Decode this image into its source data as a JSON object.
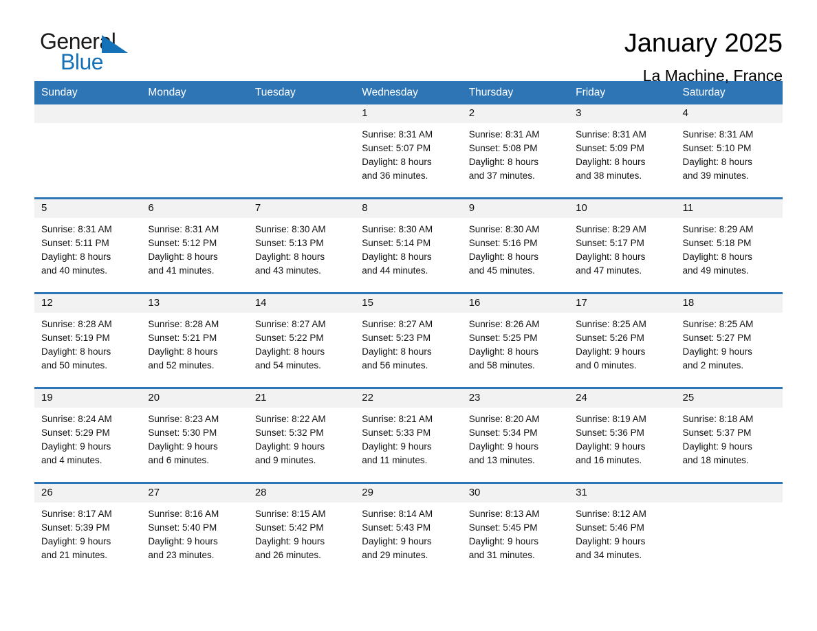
{
  "brand": {
    "word_general": "General",
    "word_blue": "Blue",
    "triangle_color": "#1572b8",
    "accent_color": "#2e75b6"
  },
  "header": {
    "title": "January 2025",
    "location": "La Machine, France"
  },
  "calendar": {
    "weekday_headers": [
      "Sunday",
      "Monday",
      "Tuesday",
      "Wednesday",
      "Thursday",
      "Friday",
      "Saturday"
    ],
    "header_bg": "#2e75b6",
    "day_band_bg": "#f2f2f2",
    "weeks": [
      [
        {
          "day": "",
          "info": ""
        },
        {
          "day": "",
          "info": ""
        },
        {
          "day": "",
          "info": ""
        },
        {
          "day": "1",
          "info": "Sunrise: 8:31 AM\nSunset: 5:07 PM\nDaylight: 8 hours\nand 36 minutes."
        },
        {
          "day": "2",
          "info": "Sunrise: 8:31 AM\nSunset: 5:08 PM\nDaylight: 8 hours\nand 37 minutes."
        },
        {
          "day": "3",
          "info": "Sunrise: 8:31 AM\nSunset: 5:09 PM\nDaylight: 8 hours\nand 38 minutes."
        },
        {
          "day": "4",
          "info": "Sunrise: 8:31 AM\nSunset: 5:10 PM\nDaylight: 8 hours\nand 39 minutes."
        }
      ],
      [
        {
          "day": "5",
          "info": "Sunrise: 8:31 AM\nSunset: 5:11 PM\nDaylight: 8 hours\nand 40 minutes."
        },
        {
          "day": "6",
          "info": "Sunrise: 8:31 AM\nSunset: 5:12 PM\nDaylight: 8 hours\nand 41 minutes."
        },
        {
          "day": "7",
          "info": "Sunrise: 8:30 AM\nSunset: 5:13 PM\nDaylight: 8 hours\nand 43 minutes."
        },
        {
          "day": "8",
          "info": "Sunrise: 8:30 AM\nSunset: 5:14 PM\nDaylight: 8 hours\nand 44 minutes."
        },
        {
          "day": "9",
          "info": "Sunrise: 8:30 AM\nSunset: 5:16 PM\nDaylight: 8 hours\nand 45 minutes."
        },
        {
          "day": "10",
          "info": "Sunrise: 8:29 AM\nSunset: 5:17 PM\nDaylight: 8 hours\nand 47 minutes."
        },
        {
          "day": "11",
          "info": "Sunrise: 8:29 AM\nSunset: 5:18 PM\nDaylight: 8 hours\nand 49 minutes."
        }
      ],
      [
        {
          "day": "12",
          "info": "Sunrise: 8:28 AM\nSunset: 5:19 PM\nDaylight: 8 hours\nand 50 minutes."
        },
        {
          "day": "13",
          "info": "Sunrise: 8:28 AM\nSunset: 5:21 PM\nDaylight: 8 hours\nand 52 minutes."
        },
        {
          "day": "14",
          "info": "Sunrise: 8:27 AM\nSunset: 5:22 PM\nDaylight: 8 hours\nand 54 minutes."
        },
        {
          "day": "15",
          "info": "Sunrise: 8:27 AM\nSunset: 5:23 PM\nDaylight: 8 hours\nand 56 minutes."
        },
        {
          "day": "16",
          "info": "Sunrise: 8:26 AM\nSunset: 5:25 PM\nDaylight: 8 hours\nand 58 minutes."
        },
        {
          "day": "17",
          "info": "Sunrise: 8:25 AM\nSunset: 5:26 PM\nDaylight: 9 hours\nand 0 minutes."
        },
        {
          "day": "18",
          "info": "Sunrise: 8:25 AM\nSunset: 5:27 PM\nDaylight: 9 hours\nand 2 minutes."
        }
      ],
      [
        {
          "day": "19",
          "info": "Sunrise: 8:24 AM\nSunset: 5:29 PM\nDaylight: 9 hours\nand 4 minutes."
        },
        {
          "day": "20",
          "info": "Sunrise: 8:23 AM\nSunset: 5:30 PM\nDaylight: 9 hours\nand 6 minutes."
        },
        {
          "day": "21",
          "info": "Sunrise: 8:22 AM\nSunset: 5:32 PM\nDaylight: 9 hours\nand 9 minutes."
        },
        {
          "day": "22",
          "info": "Sunrise: 8:21 AM\nSunset: 5:33 PM\nDaylight: 9 hours\nand 11 minutes."
        },
        {
          "day": "23",
          "info": "Sunrise: 8:20 AM\nSunset: 5:34 PM\nDaylight: 9 hours\nand 13 minutes."
        },
        {
          "day": "24",
          "info": "Sunrise: 8:19 AM\nSunset: 5:36 PM\nDaylight: 9 hours\nand 16 minutes."
        },
        {
          "day": "25",
          "info": "Sunrise: 8:18 AM\nSunset: 5:37 PM\nDaylight: 9 hours\nand 18 minutes."
        }
      ],
      [
        {
          "day": "26",
          "info": "Sunrise: 8:17 AM\nSunset: 5:39 PM\nDaylight: 9 hours\nand 21 minutes."
        },
        {
          "day": "27",
          "info": "Sunrise: 8:16 AM\nSunset: 5:40 PM\nDaylight: 9 hours\nand 23 minutes."
        },
        {
          "day": "28",
          "info": "Sunrise: 8:15 AM\nSunset: 5:42 PM\nDaylight: 9 hours\nand 26 minutes."
        },
        {
          "day": "29",
          "info": "Sunrise: 8:14 AM\nSunset: 5:43 PM\nDaylight: 9 hours\nand 29 minutes."
        },
        {
          "day": "30",
          "info": "Sunrise: 8:13 AM\nSunset: 5:45 PM\nDaylight: 9 hours\nand 31 minutes."
        },
        {
          "day": "31",
          "info": "Sunrise: 8:12 AM\nSunset: 5:46 PM\nDaylight: 9 hours\nand 34 minutes."
        },
        {
          "day": "",
          "info": ""
        }
      ]
    ]
  }
}
